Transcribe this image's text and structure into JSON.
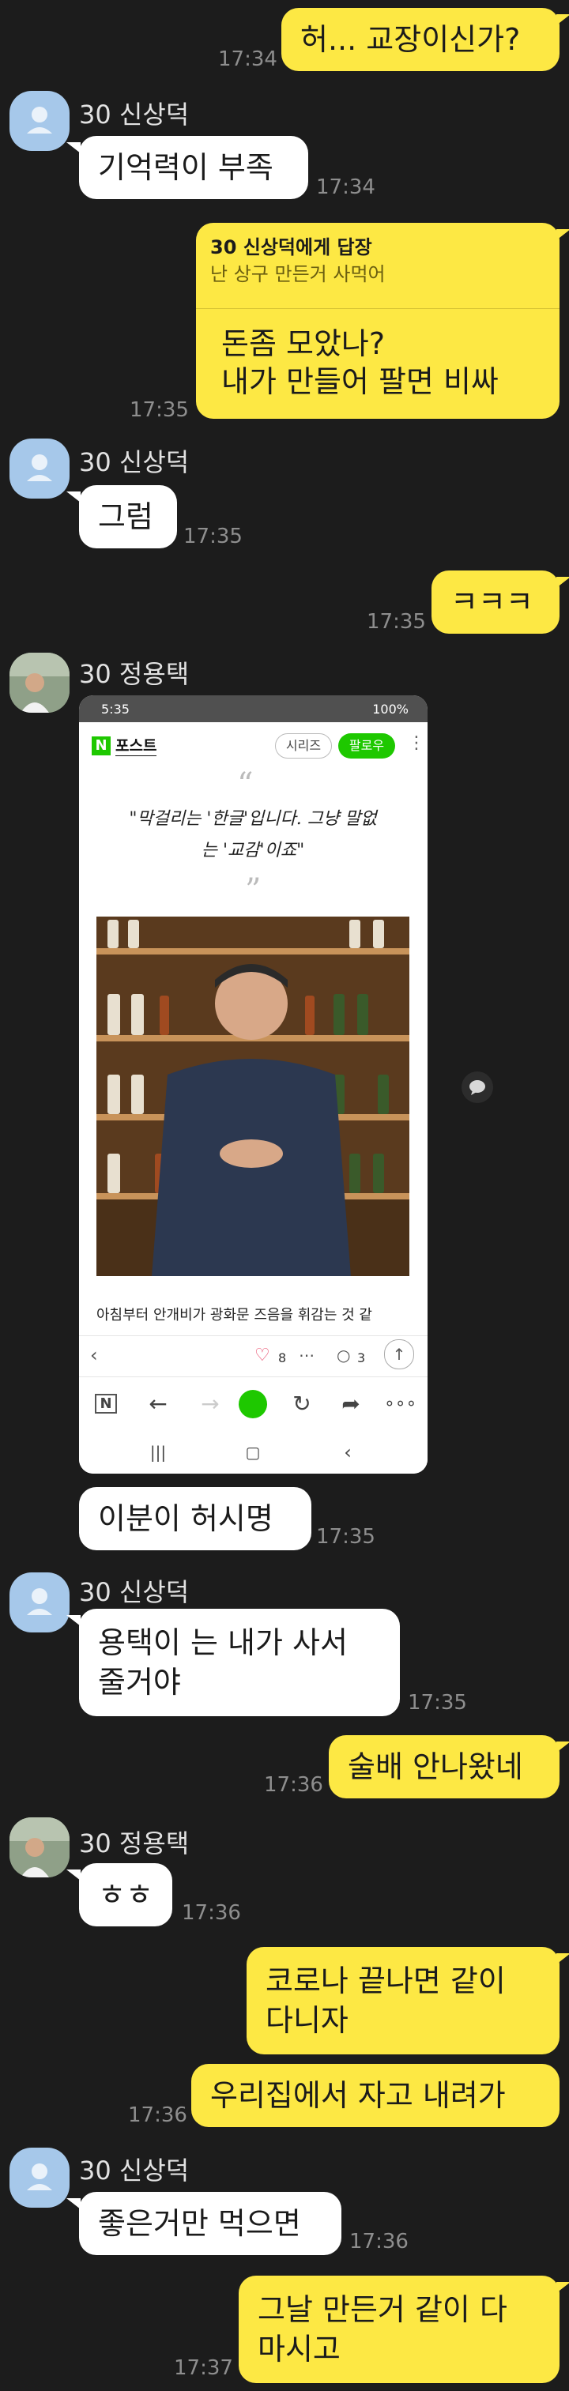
{
  "messages": {
    "m1": {
      "text": "허... 교장이신가?",
      "time": "17:34"
    },
    "m2": {
      "sender": "30 신상덕",
      "text": "기억력이 부족",
      "time": "17:34"
    },
    "m3": {
      "reply_to": "30 신상덕에게 답장",
      "reply_quote": "난 상구 만든거 사먹어",
      "line1": "돈좀 모았나?",
      "line2": "내가 만들어 팔면 비싸",
      "time": "17:35"
    },
    "m4": {
      "sender": "30 신상덕",
      "text": "그럼",
      "time": "17:35"
    },
    "m5": {
      "text": "ㅋㅋㅋ",
      "time": "17:35"
    },
    "m6": {
      "sender": "30 정용택"
    },
    "m7": {
      "text": "이분이 허시명",
      "time": "17:35"
    },
    "m8": {
      "sender": "30 신상덕",
      "line1": "용택이 는 내가 사서",
      "line2": "줄거야",
      "time": "17:35"
    },
    "m9": {
      "text": "술배 안나왔네",
      "time": "17:36"
    },
    "m10": {
      "sender": "30 정용택",
      "text": "ㅎㅎ",
      "time": "17:36"
    },
    "m11": {
      "line1": "코로나 끝나면 같이",
      "line2": "다니자"
    },
    "m12": {
      "text": "우리집에서 자고 내려가",
      "time": "17:36"
    },
    "m13": {
      "sender": "30 신상덕",
      "text": "좋은거만 먹으면",
      "time": "17:36"
    },
    "m14": {
      "line1": "그날 만든거 같이 다",
      "line2": "마시고",
      "time": "17:37"
    }
  },
  "phone": {
    "status_left": "5:35",
    "status_right": "100%",
    "app_name": "포스트",
    "series_btn": "시리즈",
    "follow_btn": "팔로우",
    "quote_line1": "\"막걸리는 '한글'입니다. 그냥 말없",
    "quote_line2": "는 '교감'이죠\"",
    "caption": "아침부터 안개비가 광화문 즈음을 휘감는 것 같",
    "likes": "8",
    "comments": "3"
  },
  "colors": {
    "my_bubble": "#fde844",
    "other_bubble": "#ffffff",
    "background": "#1c1c1c",
    "follow_green": "#1ec800"
  }
}
